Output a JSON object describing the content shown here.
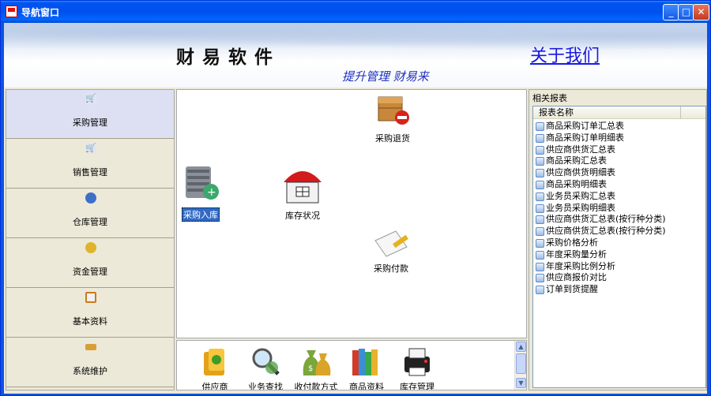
{
  "window": {
    "title": "导航窗口"
  },
  "banner": {
    "app_name": "财易软件",
    "about_link": "关于我们",
    "slogan": "提升管理 财易来"
  },
  "sidebar": {
    "items": [
      {
        "label": "采购管理",
        "icon": "cart-icon",
        "active": true
      },
      {
        "label": "销售管理",
        "icon": "cart-icon",
        "active": false
      },
      {
        "label": "仓库管理",
        "icon": "database-icon",
        "active": false
      },
      {
        "label": "资金管理",
        "icon": "coins-icon",
        "active": false
      },
      {
        "label": "基本资料",
        "icon": "card-icon",
        "active": false
      },
      {
        "label": "系统维护",
        "icon": "hammer-icon",
        "active": false
      }
    ]
  },
  "canvas": {
    "nodes": [
      {
        "label": "采购退货",
        "icon": "box-return-icon"
      },
      {
        "label": "采购入库",
        "icon": "server-add-icon",
        "selected": true
      },
      {
        "label": "库存状况",
        "icon": "warehouse-icon"
      },
      {
        "label": "采购付款",
        "icon": "payment-icon"
      }
    ]
  },
  "shelf": {
    "items": [
      {
        "label": "供应商",
        "icon": "supplier-icon"
      },
      {
        "label": "业务查找",
        "icon": "magnifier-icon"
      },
      {
        "label": "收付款方式",
        "icon": "money-bag-icon"
      },
      {
        "label": "商品资料",
        "icon": "books-icon"
      },
      {
        "label": "库存管理",
        "icon": "printer-icon"
      }
    ]
  },
  "reports": {
    "title": "相关报表",
    "column_header": "报表名称",
    "items": [
      "商品采购订单汇总表",
      "商品采购订单明细表",
      "供应商供货汇总表",
      "商品采购汇总表",
      "供应商供货明细表",
      "商品采购明细表",
      "业务员采购汇总表",
      "业务员采购明细表",
      "供应商供货汇总表(按行种分类)",
      "供应商供货汇总表(按行种分类)",
      "采购价格分析",
      "年度采购量分析",
      "年度采购比例分析",
      "供应商报价对比",
      "订单到货提醒"
    ]
  }
}
